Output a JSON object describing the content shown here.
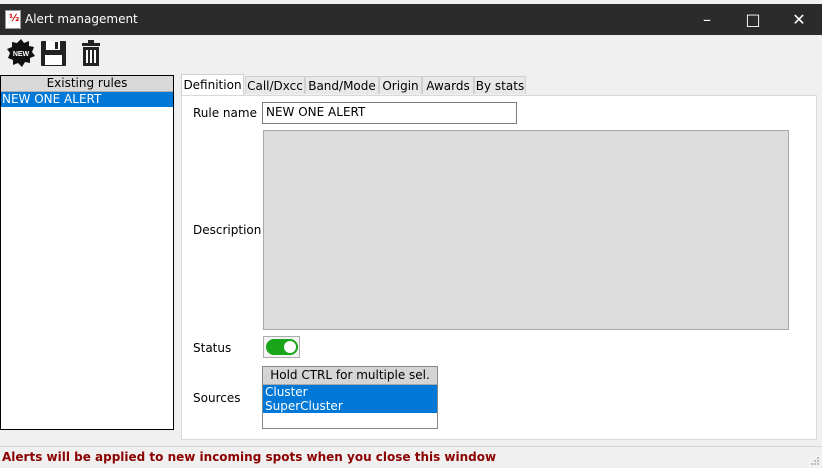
{
  "window": {
    "title": "Alert management",
    "app_icon_text": "½",
    "minimize_label": "–",
    "maximize_label": "□",
    "close_label": "✕"
  },
  "toolbar": {
    "new_label": "NEW",
    "icons": [
      "new-icon",
      "save-icon",
      "delete-icon"
    ]
  },
  "rules_panel": {
    "header": "Existing rules",
    "items": [
      "NEW ONE ALERT"
    ]
  },
  "tabs": [
    "Definition",
    "Call/Dxcc",
    "Band/Mode",
    "Origin",
    "Awards",
    "By stats"
  ],
  "active_tab": "Definition",
  "form": {
    "rule_name_label": "Rule name",
    "rule_name_value": "NEW ONE ALERT",
    "description_label": "Description",
    "description_value": "",
    "status_label": "Status",
    "status_on": true,
    "sources_label": "Sources",
    "sources_header": "Hold CTRL for multiple sel.",
    "sources_items": [
      "Cluster",
      "SuperCluster"
    ]
  },
  "statusbar": {
    "message": "Alerts will be applied to new incoming spots when you close this window"
  },
  "colors": {
    "titlebar": "#2b2b2b",
    "selection": "#0078d7",
    "toggle_on": "#19a519",
    "status_text": "#8b0000"
  }
}
